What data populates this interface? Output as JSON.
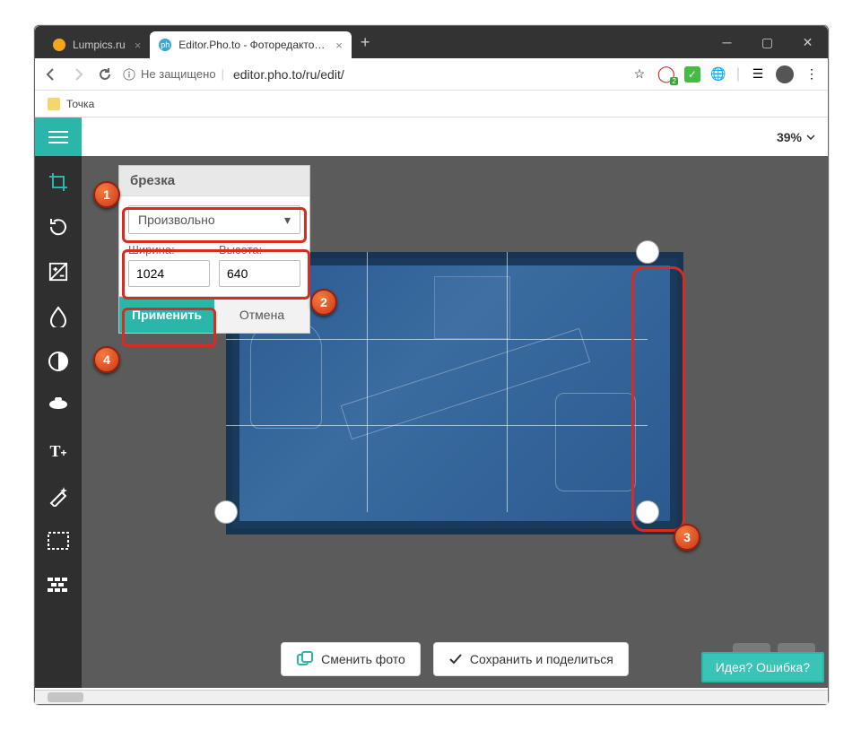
{
  "browser": {
    "tabs": [
      {
        "title": "Lumpics.ru",
        "active": false
      },
      {
        "title": "Editor.Pho.to - Фоторедактор он",
        "active": true
      }
    ],
    "nav": {
      "security": "Не защищено",
      "url": "editor.pho.to/ru/edit/"
    },
    "bookmark": "Точка",
    "ext_badge": "2"
  },
  "toolbar": {
    "zoom": "39%"
  },
  "panel": {
    "title": "брезка",
    "dropdown": "Произвольно",
    "width_label": "Ширина:",
    "height_label": "Высота:",
    "width": "1024",
    "height": "640",
    "apply": "Применить",
    "cancel": "Отмена"
  },
  "bottom": {
    "change": "Сменить фото",
    "save": "Сохранить и поделиться"
  },
  "feedback": "Идея? Ошибка?",
  "markers": {
    "m1": "1",
    "m2": "2",
    "m3": "3",
    "m4": "4"
  }
}
